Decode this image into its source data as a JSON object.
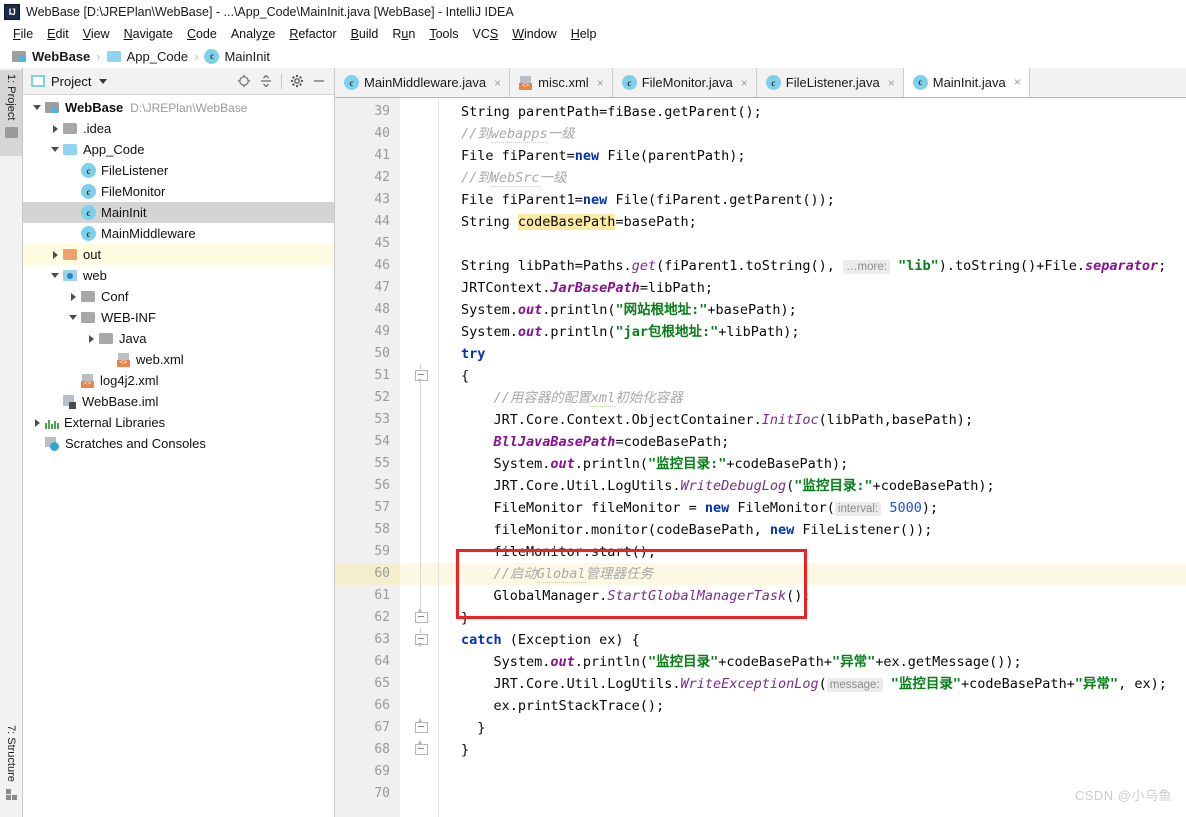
{
  "window": {
    "logo_text": "IJ",
    "title": "WebBase [D:\\JREPlan\\WebBase] - ...\\App_Code\\MainInit.java [WebBase] - IntelliJ IDEA"
  },
  "menubar": {
    "items": [
      {
        "label": "File",
        "mnemonic": "F"
      },
      {
        "label": "Edit",
        "mnemonic": "E"
      },
      {
        "label": "View",
        "mnemonic": "V"
      },
      {
        "label": "Navigate",
        "mnemonic": "N"
      },
      {
        "label": "Code",
        "mnemonic": "C"
      },
      {
        "label": "Analyze",
        "mnemonic": "z"
      },
      {
        "label": "Refactor",
        "mnemonic": "R"
      },
      {
        "label": "Build",
        "mnemonic": "B"
      },
      {
        "label": "Run",
        "mnemonic": "u"
      },
      {
        "label": "Tools",
        "mnemonic": "T"
      },
      {
        "label": "VCS",
        "mnemonic": "S"
      },
      {
        "label": "Window",
        "mnemonic": "W"
      },
      {
        "label": "Help",
        "mnemonic": "H"
      }
    ]
  },
  "breadcrumb": {
    "items": [
      {
        "label": "WebBase",
        "icon": "module-folder-icon",
        "bold": true
      },
      {
        "label": "App_Code",
        "icon": "folder-icon",
        "bold": false
      },
      {
        "label": "MainInit",
        "icon": "java-class-icon",
        "bold": false
      }
    ],
    "separator": "›"
  },
  "left_toolbar": {
    "project_tab": "1: Project",
    "structure_tab": "7: Structure"
  },
  "project_panel": {
    "title": "Project",
    "actions": [
      {
        "name": "locate-icon",
        "glyph": "⊕"
      },
      {
        "name": "collapse-all-icon",
        "glyph": "≡"
      },
      {
        "name": "settings-gear-icon",
        "glyph": "⚙"
      },
      {
        "name": "minimize-icon",
        "glyph": "—"
      }
    ],
    "tree": [
      {
        "label": "WebBase",
        "sub": "D:\\JREPlan\\WebBase",
        "depth": 0,
        "toggle": "down",
        "icon": "module-folder-icon",
        "bold": true,
        "state": "none"
      },
      {
        "label": ".idea",
        "sub": "",
        "depth": 1,
        "toggle": "right",
        "icon": "folder-gray-icon",
        "bold": false,
        "state": "none"
      },
      {
        "label": "App_Code",
        "sub": "",
        "depth": 1,
        "toggle": "down",
        "icon": "folder-blue-icon",
        "bold": false,
        "state": "none"
      },
      {
        "label": "FileListener",
        "sub": "",
        "depth": 2,
        "toggle": "none",
        "icon": "java-class-icon",
        "bold": false,
        "state": "none"
      },
      {
        "label": "FileMonitor",
        "sub": "",
        "depth": 2,
        "toggle": "none",
        "icon": "java-class-icon",
        "bold": false,
        "state": "none"
      },
      {
        "label": "MainInit",
        "sub": "",
        "depth": 2,
        "toggle": "none",
        "icon": "java-class-icon",
        "bold": false,
        "state": "selected"
      },
      {
        "label": "MainMiddleware",
        "sub": "",
        "depth": 2,
        "toggle": "none",
        "icon": "java-class-icon",
        "bold": false,
        "state": "none"
      },
      {
        "label": "out",
        "sub": "",
        "depth": 1,
        "toggle": "right",
        "icon": "folder-orange-icon",
        "bold": false,
        "state": "highlight"
      },
      {
        "label": "web",
        "sub": "",
        "depth": 1,
        "toggle": "down",
        "icon": "folder-source-icon",
        "bold": false,
        "state": "none"
      },
      {
        "label": "Conf",
        "sub": "",
        "depth": 2,
        "toggle": "right",
        "icon": "folder-gray-icon",
        "bold": false,
        "state": "none"
      },
      {
        "label": "WEB-INF",
        "sub": "",
        "depth": 2,
        "toggle": "down",
        "icon": "folder-gray-icon",
        "bold": false,
        "state": "none"
      },
      {
        "label": "Java",
        "sub": "",
        "depth": 3,
        "toggle": "right",
        "icon": "folder-gray-icon",
        "bold": false,
        "state": "none"
      },
      {
        "label": "web.xml",
        "sub": "",
        "depth": 4,
        "toggle": "none",
        "icon": "xml-file-icon",
        "bold": false,
        "state": "none"
      },
      {
        "label": "log4j2.xml",
        "sub": "",
        "depth": 2,
        "toggle": "none",
        "icon": "xml-file-icon",
        "bold": false,
        "state": "none"
      },
      {
        "label": "WebBase.iml",
        "sub": "",
        "depth": 1,
        "toggle": "none",
        "icon": "iml-file-icon",
        "bold": false,
        "state": "none"
      },
      {
        "label": "External Libraries",
        "sub": "",
        "depth": 0,
        "toggle": "right",
        "icon": "libraries-icon",
        "bold": false,
        "state": "none"
      },
      {
        "label": "Scratches and Consoles",
        "sub": "",
        "depth": 0,
        "toggle": "none",
        "icon": "scratches-icon",
        "bold": false,
        "state": "none"
      }
    ]
  },
  "editor": {
    "tabs": [
      {
        "label": "MainMiddleware.java",
        "icon": "java-class-icon",
        "active": false,
        "close": "×"
      },
      {
        "label": "misc.xml",
        "icon": "xml-file-icon",
        "active": false,
        "close": "×"
      },
      {
        "label": "FileMonitor.java",
        "icon": "java-class-icon",
        "active": false,
        "close": "×"
      },
      {
        "label": "FileListener.java",
        "icon": "java-class-icon",
        "active": false,
        "close": "×"
      },
      {
        "label": "MainInit.java",
        "icon": "java-class-icon",
        "active": true,
        "close": "×"
      }
    ],
    "first_line_number": 39,
    "last_line_number": 70,
    "highlighted_line": 60,
    "line_numbers": [
      39,
      40,
      41,
      42,
      43,
      44,
      45,
      46,
      47,
      48,
      49,
      50,
      51,
      52,
      53,
      54,
      55,
      56,
      57,
      58,
      59,
      60,
      61,
      62,
      63,
      64,
      65,
      66,
      67,
      68,
      69,
      70
    ],
    "code_lines": [
      {
        "n": 39,
        "text": "String parentPath=fiBase.getParent();"
      },
      {
        "n": 40,
        "text": "//到webapps一级"
      },
      {
        "n": 41,
        "text": "File fiParent=new File(parentPath);"
      },
      {
        "n": 42,
        "text": "//到WebSrc一级"
      },
      {
        "n": 43,
        "text": "File fiParent1=new File(fiParent.getParent());"
      },
      {
        "n": 44,
        "text": "String codeBasePath=basePath;"
      },
      {
        "n": 45,
        "text": ""
      },
      {
        "n": 46,
        "text": "String libPath=Paths.get(fiParent1.toString(), ...more: \"lib\").toString()+File.separator;"
      },
      {
        "n": 47,
        "text": "JRTContext.JarBasePath=libPath;"
      },
      {
        "n": 48,
        "text": "System.out.println(\"网站根地址:\"+basePath);"
      },
      {
        "n": 49,
        "text": "System.out.println(\"jar包根地址:\"+libPath);"
      },
      {
        "n": 50,
        "text": "try"
      },
      {
        "n": 51,
        "text": "{"
      },
      {
        "n": 52,
        "text": "//用容器的配置xml初始化容器"
      },
      {
        "n": 53,
        "text": "JRT.Core.Context.ObjectContainer.InitIoc(libPath,basePath);"
      },
      {
        "n": 54,
        "text": "BllJavaBasePath=codeBasePath;"
      },
      {
        "n": 55,
        "text": "System.out.println(\"监控目录:\"+codeBasePath);"
      },
      {
        "n": 56,
        "text": "JRT.Core.Util.LogUtils.WriteDebugLog(\"监控目录:\"+codeBasePath);"
      },
      {
        "n": 57,
        "text": "FileMonitor fileMonitor = new FileMonitor( interval: 5000);"
      },
      {
        "n": 58,
        "text": "fileMonitor.monitor(codeBasePath, new FileListener());"
      },
      {
        "n": 59,
        "text": "fileMonitor.start();"
      },
      {
        "n": 60,
        "text": "//启动Global管理器任务"
      },
      {
        "n": 61,
        "text": "GlobalManager.StartGlobalManagerTask();"
      },
      {
        "n": 62,
        "text": "}"
      },
      {
        "n": 63,
        "text": "catch (Exception ex) {"
      },
      {
        "n": 64,
        "text": "System.out.println(\"监控目录\"+codeBasePath+\"异常\"+ex.getMessage());"
      },
      {
        "n": 65,
        "text": "JRT.Core.Util.LogUtils.WriteExceptionLog( message: \"监控目录\"+codeBasePath+\"异常\", ex);"
      },
      {
        "n": 66,
        "text": "ex.printStackTrace();"
      },
      {
        "n": 67,
        "text": "}"
      },
      {
        "n": 68,
        "text": "}"
      },
      {
        "n": 69,
        "text": "}"
      },
      {
        "n": 70,
        "text": ""
      }
    ],
    "inlay_hints": [
      {
        "line": 46,
        "label": "…more:"
      },
      {
        "line": 57,
        "label": "interval:"
      },
      {
        "line": 65,
        "label": "message:"
      }
    ],
    "fold_lines": [
      51,
      62,
      63,
      67,
      68
    ],
    "annotation": {
      "name": "red-highlight-box",
      "color": "#ee2222"
    }
  },
  "watermark": {
    "text": "CSDN @小乌鱼"
  },
  "colors": {
    "keyword": "#0033b3",
    "string": "#067d17",
    "comment": "#a8a8a8",
    "static_field": "#871094",
    "number": "#1750eb",
    "selection": "#d4d4d4",
    "line_highlight": "#fdf8e3",
    "annotation_red": "#ee2222"
  }
}
